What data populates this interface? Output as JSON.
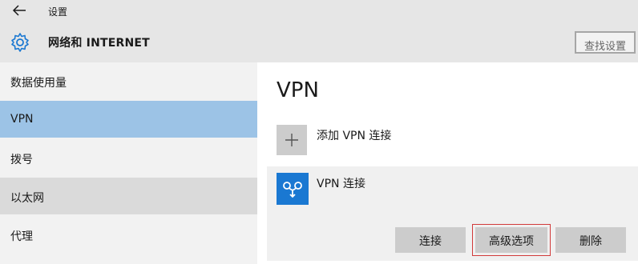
{
  "window": {
    "title": "设置"
  },
  "header": {
    "title": "网络和 INTERNET",
    "search_placeholder": "查找设置"
  },
  "sidebar": {
    "items": [
      {
        "label": "数据使用量"
      },
      {
        "label": "VPN"
      },
      {
        "label": "拨号"
      },
      {
        "label": "以太网"
      },
      {
        "label": "代理"
      }
    ],
    "selected": "VPN"
  },
  "main": {
    "heading": "VPN",
    "add_label": "添加 VPN 连接",
    "connection": {
      "name": "VPN 连接",
      "buttons": {
        "connect": "连接",
        "advanced": "高级选项",
        "delete": "删除"
      }
    }
  },
  "colors": {
    "accent": "#1a78d2",
    "selected": "#9cc3e6",
    "highlight_border": "#d13a3a"
  },
  "icons": {
    "back": "back-arrow-icon",
    "settings": "gear-icon",
    "add": "plus-icon",
    "vpn": "vpn-icon"
  }
}
